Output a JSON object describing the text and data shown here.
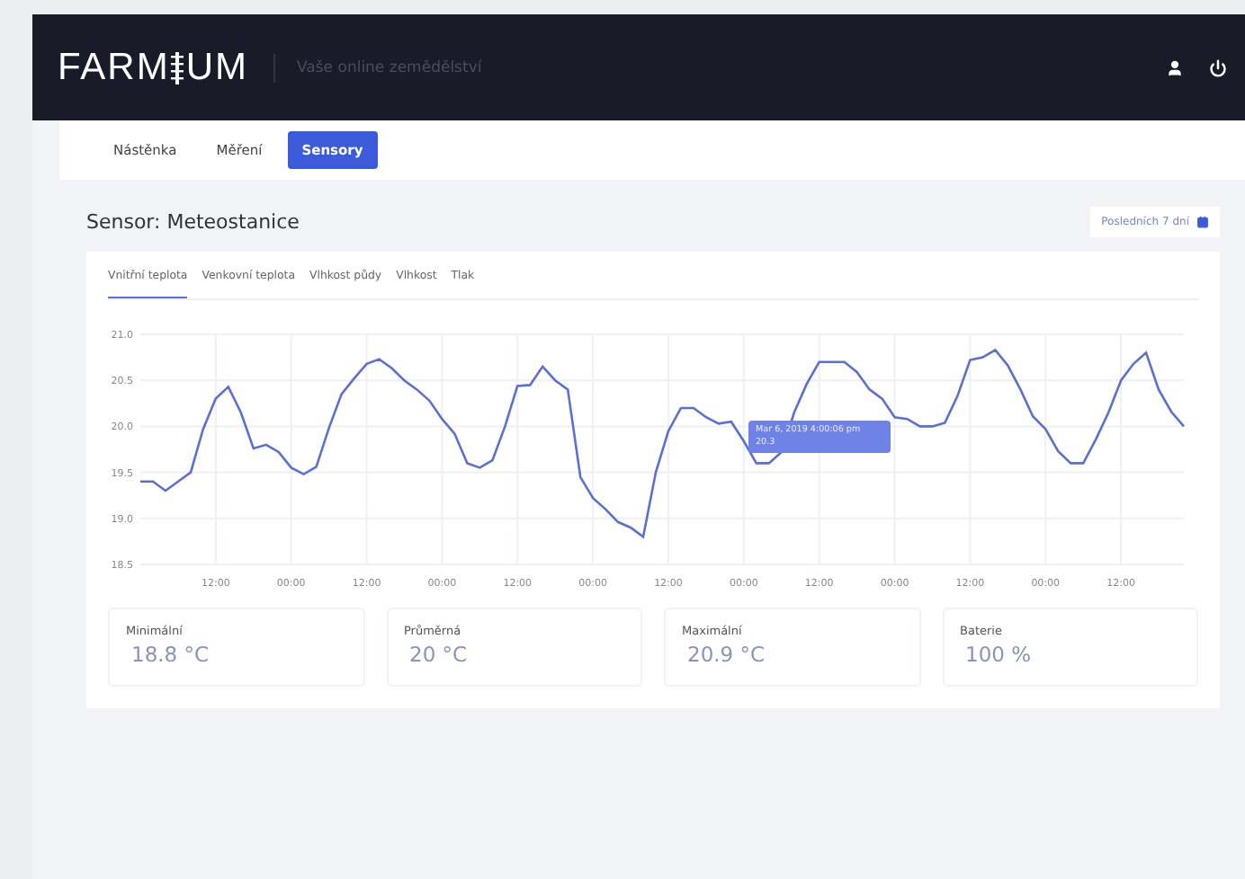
{
  "header": {
    "logo_left": "FARM",
    "logo_right": "UM",
    "tagline": "Vaše online zemědělství"
  },
  "nav": [
    {
      "label": "Nástěnka",
      "selected": false
    },
    {
      "label": "Měření",
      "selected": false
    },
    {
      "label": "Sensory",
      "selected": true
    }
  ],
  "page": {
    "title": "Sensor: Meteostanice",
    "date_range": "Posledních 7 dní"
  },
  "metric_tabs": [
    {
      "label": "Vnitřní teplota",
      "selected": true
    },
    {
      "label": "Venkovní teplota",
      "selected": false
    },
    {
      "label": "Vlhkost půdy",
      "selected": false
    },
    {
      "label": "Vlhkost",
      "selected": false
    },
    {
      "label": "Tlak",
      "selected": false
    }
  ],
  "chart": {
    "tooltip": {
      "title": "Mar 6, 2019 4:00:06 pm",
      "value": "20.3"
    },
    "x_axis_labels": [
      "12:00",
      "00:00",
      "12:00",
      "00:00",
      "12:00",
      "00:00",
      "12:00",
      "00:00",
      "12:00",
      "00:00",
      "12:00",
      "00:00",
      "12:00"
    ],
    "chart_data": {
      "type": "line",
      "grid": true,
      "ylim": [
        18.5,
        21.0
      ],
      "yticks": [
        {
          "value": 18.5,
          "label": "18.5"
        },
        {
          "value": 19,
          "label": "19.0"
        },
        {
          "value": 19.5,
          "label": "19.5"
        },
        {
          "value": 20,
          "label": "20.0"
        },
        {
          "value": 20.5,
          "label": "20.5"
        },
        {
          "value": 21,
          "label": "21.0"
        }
      ],
      "series": [
        {
          "color": "#5b6fd6",
          "values": [
            19.4,
            19.4,
            19.3,
            19.4,
            19.5,
            19.97,
            20.3,
            20.43,
            20.15,
            19.76,
            19.8,
            19.72,
            19.55,
            19.48,
            19.56,
            19.98,
            20.35,
            20.52,
            20.68,
            20.73,
            20.63,
            20.5,
            20.4,
            20.28,
            20.08,
            19.92,
            19.6,
            19.55,
            19.63,
            20.0,
            20.44,
            20.45,
            20.65,
            20.5,
            20.4,
            19.45,
            19.22,
            19.1,
            18.96,
            18.9,
            18.8,
            19.5,
            19.95,
            20.2,
            20.2,
            20.1,
            20.03,
            20.05,
            19.84,
            19.6,
            19.6,
            19.72,
            20.15,
            20.46,
            20.7,
            20.7,
            20.7,
            20.59,
            20.4,
            20.3,
            20.1,
            20.08,
            20.0,
            20.0,
            20.04,
            20.33,
            20.72,
            20.75,
            20.83,
            20.66,
            20.4,
            20.11,
            19.97,
            19.73,
            19.6,
            19.6,
            19.86,
            20.15,
            20.5,
            20.68,
            20.8,
            20.4,
            20.16,
            20.0
          ]
        }
      ]
    }
  },
  "stats": [
    {
      "label": "Minimální",
      "value": "18.8 °C"
    },
    {
      "label": "Průměrná",
      "value": "20 °C"
    },
    {
      "label": "Maximální",
      "value": "20.9 °C"
    },
    {
      "label": "Baterie",
      "value": "100 %"
    }
  ]
}
